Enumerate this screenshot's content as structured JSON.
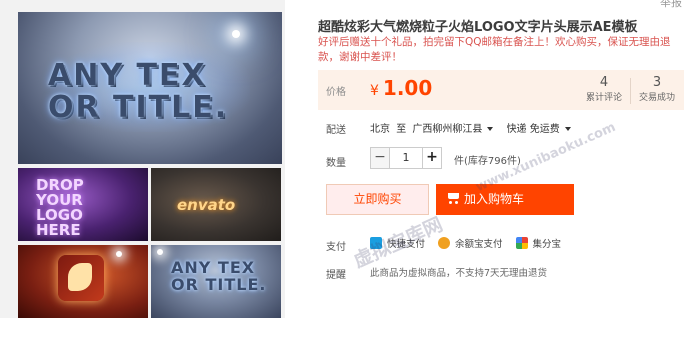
{
  "top_cut_text": "举报",
  "gallery": {
    "main_art_text": "ANY TEX\nOR TITLE.",
    "thumbs": [
      {
        "art_text": "DROP\nYOUR\nLOGO\nHERE"
      },
      {
        "art_text": "envato"
      },
      {
        "art_text": ""
      },
      {
        "art_text": "ANY TEX\nOR TITLE."
      }
    ]
  },
  "product": {
    "title": "超酷炫彩大气燃烧粒子火焰LOGO文字片头展示AE模板",
    "subtitle": "好评后赠送十个礼品，拍完留下QQ邮箱在备注上！欢心购买，保证无理由退款，谢谢中差评！"
  },
  "price": {
    "label": "价格",
    "currency": "¥",
    "value": "1.00",
    "reviews_count": "4",
    "reviews_label": "累计评论",
    "deals_count": "3",
    "deals_label": "交易成功"
  },
  "shipping": {
    "label": "配送",
    "from": "北京",
    "to_word": "至",
    "destination": "广西柳州柳江县",
    "method": "快递 免运费"
  },
  "quantity": {
    "label": "数量",
    "minus": "−",
    "value": "1",
    "plus": "+",
    "stock_text": "件(库存796件)"
  },
  "actions": {
    "buy_now": "立即购买",
    "add_to_cart": "加入购物车"
  },
  "payment": {
    "label": "支付",
    "methods": [
      "快捷支付",
      "余额宝支付",
      "集分宝"
    ]
  },
  "notice": {
    "label": "提醒",
    "text": "此商品为虚拟商品，不支持7天无理由退货"
  },
  "watermark": {
    "brand": "虚拟宝库网",
    "url": "www.xunibaoku.com"
  },
  "colors": {
    "accent": "#ff4400",
    "price_bg": "#fdf1e8",
    "buy_now_bg": "#ffeded"
  }
}
